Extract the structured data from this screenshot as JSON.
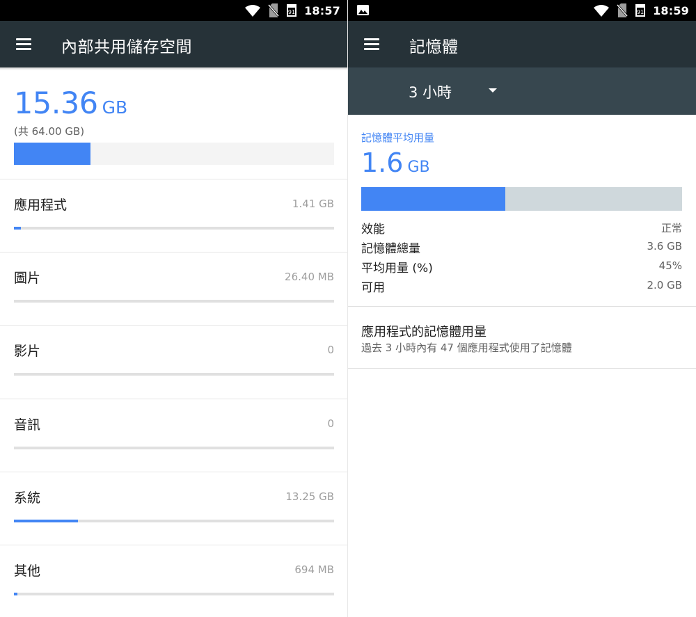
{
  "storage_screen": {
    "status_bar": {
      "time": "18:57",
      "icons": [
        "wifi-icon",
        "no-sim-icon",
        "calendar-icon"
      ]
    },
    "app_bar": {
      "title": "內部共用儲存空間",
      "menu_icon": "hamburger-menu-icon"
    },
    "summary": {
      "used_value": "15.36",
      "used_unit": "GB",
      "total_text": "(共 64.00 GB)",
      "used_fraction": 0.24
    },
    "categories": [
      {
        "name": "應用程式",
        "size": "1.41 GB",
        "fraction": 0.022
      },
      {
        "name": "圖片",
        "size": "26.40 MB",
        "fraction": 0.0
      },
      {
        "name": "影片",
        "size": "0",
        "fraction": 0.0
      },
      {
        "name": "音訊",
        "size": "0",
        "fraction": 0.0
      },
      {
        "name": "系統",
        "size": "13.25 GB",
        "fraction": 0.2
      },
      {
        "name": "其他",
        "size": "694 MB",
        "fraction": 0.011
      }
    ]
  },
  "memory_screen": {
    "status_bar": {
      "time": "18:59",
      "icons": [
        "image-notification-icon",
        "wifi-icon",
        "no-sim-icon",
        "calendar-icon"
      ]
    },
    "app_bar": {
      "title": "記憶體",
      "menu_icon": "hamburger-menu-icon"
    },
    "time_filter": {
      "selected": "3 小時",
      "icon": "dropdown-caret-icon"
    },
    "average": {
      "label": "記憶體平均用量",
      "value": "1.6",
      "unit": "GB",
      "fraction": 0.45
    },
    "stats": [
      {
        "label": "效能",
        "value": "正常"
      },
      {
        "label": "記憶體總量",
        "value": "3.6 GB"
      },
      {
        "label": "平均用量 (%)",
        "value": "45%"
      },
      {
        "label": "可用",
        "value": "2.0 GB"
      }
    ],
    "apps_memory": {
      "title": "應用程式的記憶體用量",
      "subtitle": "過去 3 小時內有 47 個應用程式使用了記憶體"
    }
  },
  "colors": {
    "accent": "#4285f4",
    "app_bar": "#263238",
    "filter_bar": "#37474f",
    "track_light": "#f4f4f4",
    "track_mid": "#e0e0e0",
    "track_memory": "#cfd8dc"
  }
}
